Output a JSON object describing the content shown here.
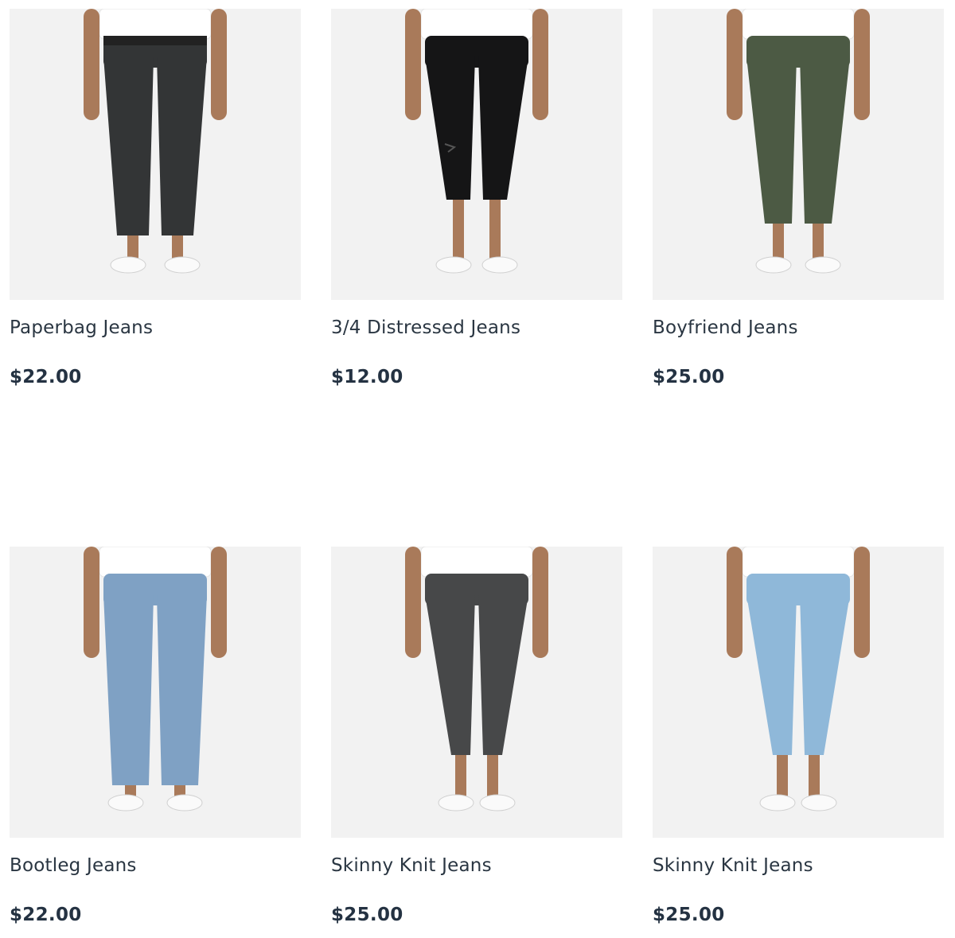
{
  "products": [
    {
      "name": "Paperbag Jeans",
      "price": "$22.00",
      "denim_color": "#333536",
      "fit": "paperbag"
    },
    {
      "name": "3/4 Distressed Jeans",
      "price": "$12.00",
      "denim_color": "#151516",
      "fit": "cropped"
    },
    {
      "name": "Boyfriend Jeans",
      "price": "$25.00",
      "denim_color": "#4c5a44",
      "fit": "boyfriend"
    },
    {
      "name": "Bootleg Jeans",
      "price": "$22.00",
      "denim_color": "#7fa1c4",
      "fit": "bootleg"
    },
    {
      "name": "Skinny Knit Jeans",
      "price": "$25.00",
      "denim_color": "#474849",
      "fit": "skinny"
    },
    {
      "name": "Skinny Knit Jeans",
      "price": "$25.00",
      "denim_color": "#8fb8d9",
      "fit": "skinny"
    }
  ],
  "colors": {
    "card_background": "#f2f2f2",
    "text": "#2a3642",
    "price": "#243242"
  }
}
